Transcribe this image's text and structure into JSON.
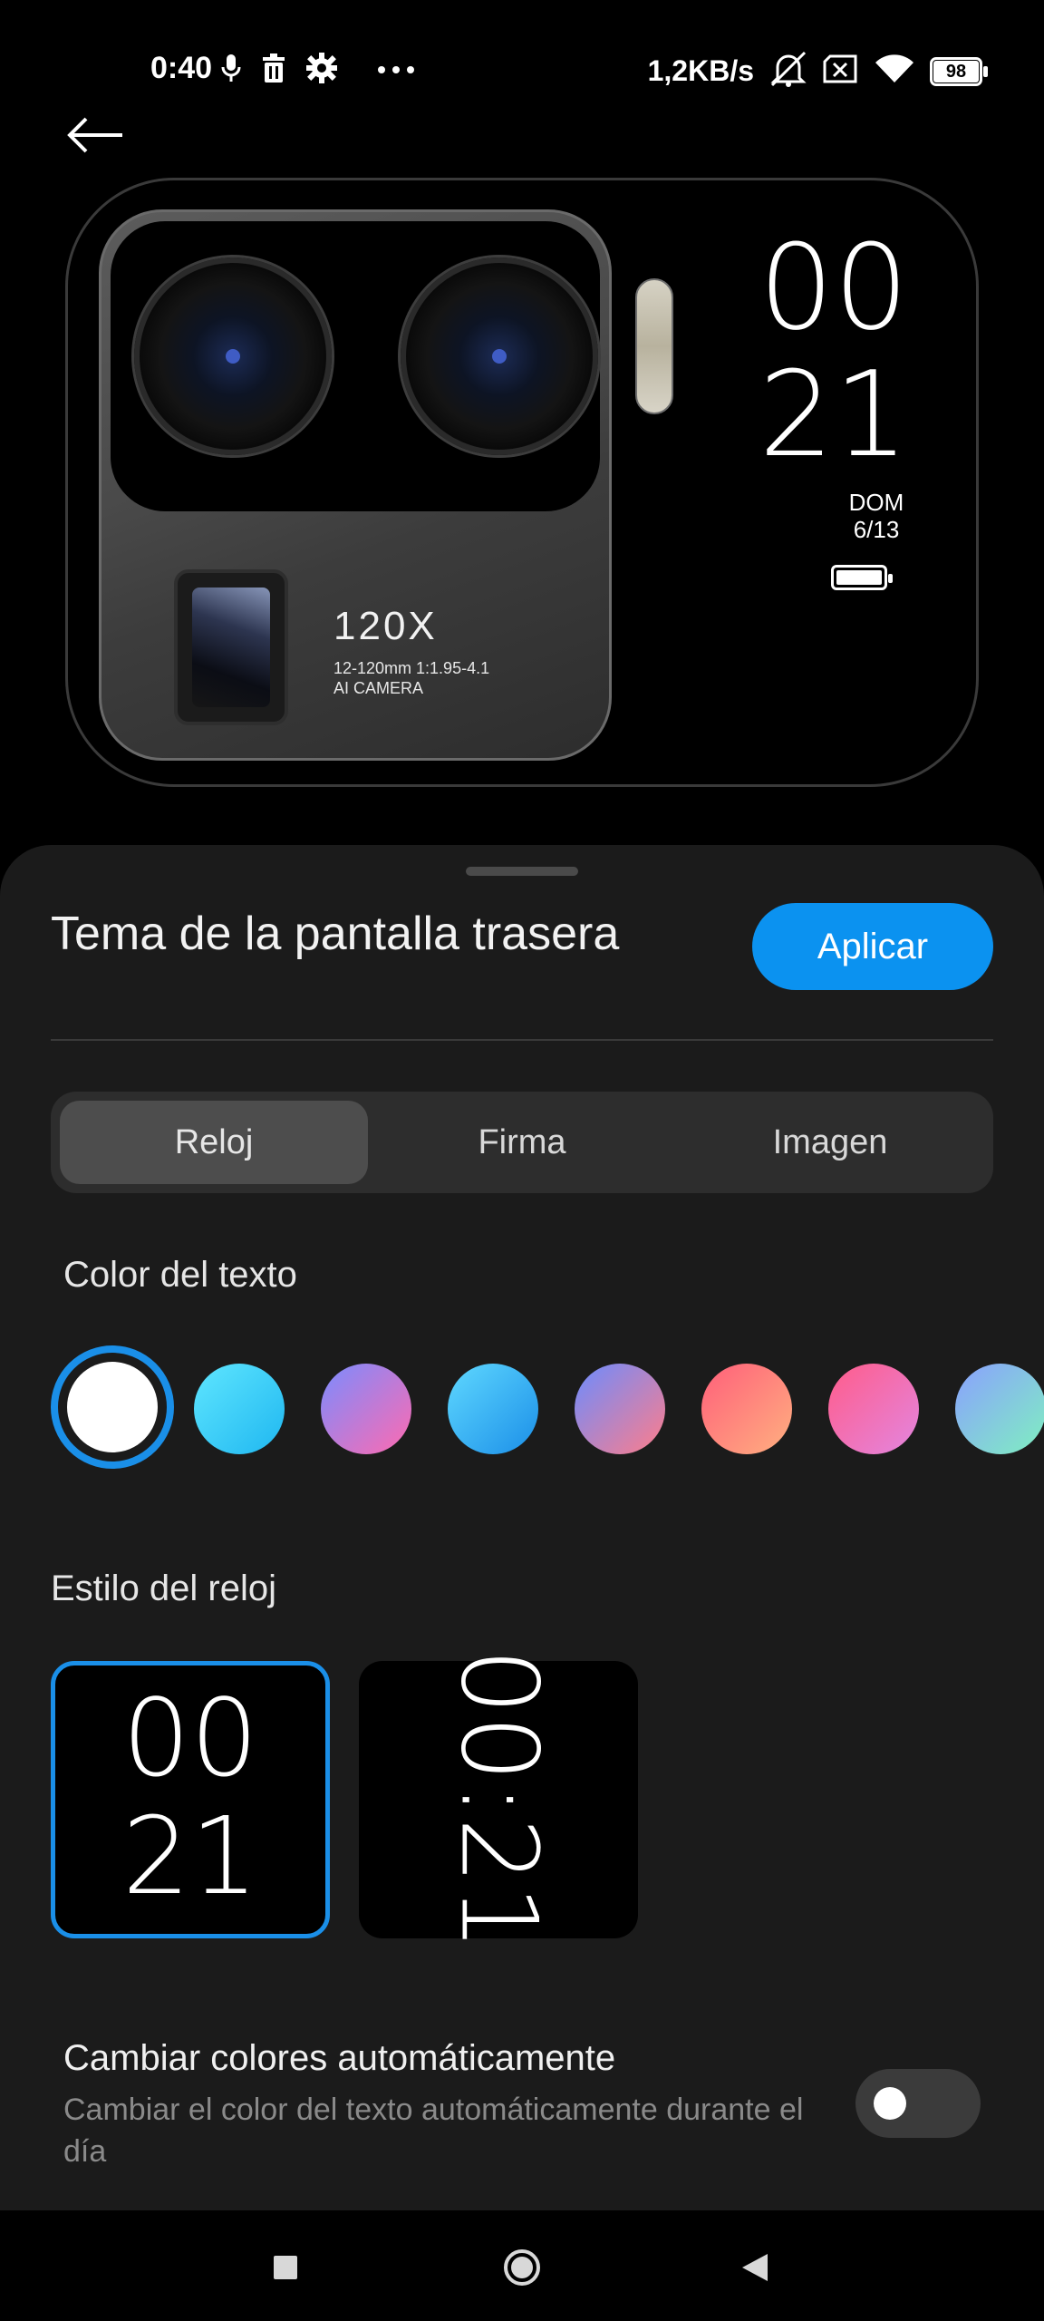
{
  "status_bar": {
    "time": "0:40",
    "net_speed": "1,2KB/s",
    "battery_level": "98",
    "icons_left": [
      "mic-icon",
      "trash-icon",
      "gear-icon",
      "more-dots-icon"
    ],
    "icons_right": [
      "mute-icon",
      "sim-off-icon",
      "wifi-icon",
      "battery-icon"
    ]
  },
  "preview": {
    "camera_brand": "120X",
    "camera_spec_line1": "12-120mm 1:1.95-4.1",
    "camera_spec_line2": "AI CAMERA",
    "clock_hour": "00",
    "clock_minute": "21",
    "day": "DOM",
    "date": "6/13"
  },
  "sheet": {
    "title": "Tema de la pantalla trasera",
    "apply_label": "Aplicar",
    "tabs": [
      {
        "label": "Reloj",
        "active": true
      },
      {
        "label": "Firma",
        "active": false
      },
      {
        "label": "Imagen",
        "active": false
      }
    ],
    "text_color_label": "Color del texto",
    "colors": [
      {
        "name": "white",
        "css": "#ffffff",
        "selected": true
      },
      {
        "name": "cyan",
        "css": "linear-gradient(135deg,#5fe6ff,#1fb7f0)"
      },
      {
        "name": "violet-pink",
        "css": "linear-gradient(135deg,#7a8cff,#ff6ab0)"
      },
      {
        "name": "sky-blue",
        "css": "linear-gradient(135deg,#5fd8ff,#1b8fe8)"
      },
      {
        "name": "blue-coral",
        "css": "linear-gradient(135deg,#6b8cff,#ff7d8a)"
      },
      {
        "name": "coral-orange",
        "css": "linear-gradient(135deg,#ff5f7a,#ffb080)"
      },
      {
        "name": "pink-magenta",
        "css": "linear-gradient(135deg,#ff5c8a,#e386e0)"
      },
      {
        "name": "blue-mint",
        "css": "linear-gradient(135deg,#8aa0ff,#7ff0c0)"
      }
    ],
    "clock_style_label": "Estilo del reloj",
    "clock_styles": [
      {
        "hour": "00",
        "minute": "21",
        "selected": true
      },
      {
        "text": "00:21",
        "selected": false
      }
    ],
    "auto_colors_title": "Cambiar colores automáticamente",
    "auto_colors_desc": "Cambiar el color del texto automáticamente durante el día",
    "auto_colors_enabled": false
  },
  "colors": {
    "accent": "#0b92f0",
    "sheet_bg": "#1b1b1b"
  }
}
